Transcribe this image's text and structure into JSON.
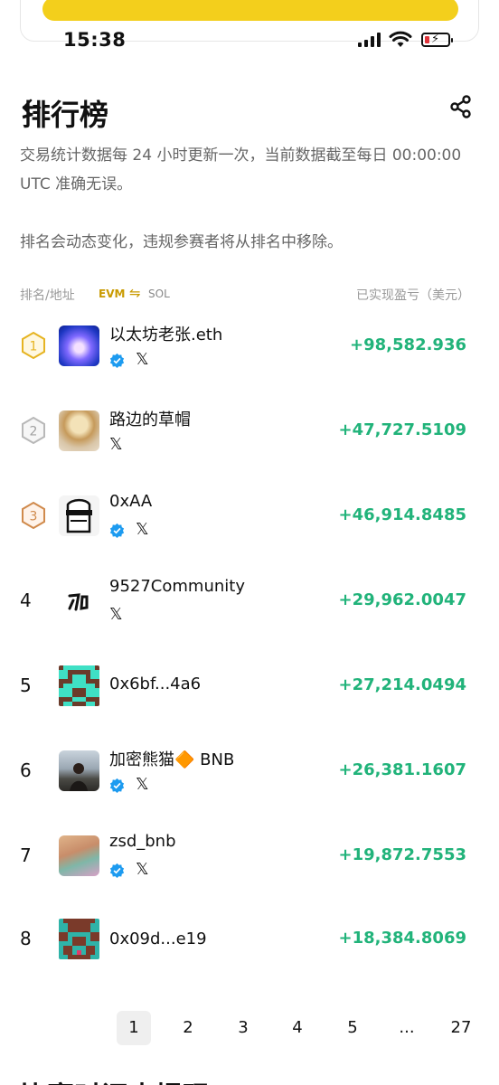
{
  "status_bar": {
    "time": "15:38"
  },
  "header": {
    "title": "排行榜",
    "back_icon": "arrow-left-icon",
    "share_icon": "share-icon"
  },
  "description": "交易统计数据每 24 小时更新一次，当前数据截至每日 00:00:00 UTC 准确无误。",
  "description2": "排名会动态变化，违规参赛者将从排名中移除。",
  "table": {
    "col_rank": "排名/地址",
    "chain_evm": "EVM",
    "chain_swap": "⇋",
    "chain_sol": "SOL",
    "col_pnl": "已实现盈亏（美元）"
  },
  "colors": {
    "positive": "#21b37a",
    "accent": "#f3cf1c"
  },
  "rows": [
    {
      "rank": "1",
      "name": "以太坊老张.eth",
      "verified": true,
      "pnl": "+98,582.936"
    },
    {
      "rank": "2",
      "name": "路边的草帽",
      "verified": false,
      "pnl": "+47,727.5109"
    },
    {
      "rank": "3",
      "name": "0xAA",
      "verified": true,
      "pnl": "+46,914.8485"
    },
    {
      "rank": "4",
      "name": "9527Community",
      "verified": false,
      "pnl": "+29,962.0047"
    },
    {
      "rank": "5",
      "name": "0x6bf...4a6",
      "verified": false,
      "pnl": "+27,214.0494"
    },
    {
      "rank": "6",
      "name": "加密熊猫🔶 BNB",
      "verified": true,
      "pnl": "+26,381.1607"
    },
    {
      "rank": "7",
      "name": "zsd_bnb",
      "verified": true,
      "pnl": "+19,872.7553"
    },
    {
      "rank": "8",
      "name": "0x09d...e19",
      "verified": false,
      "pnl": "+18,384.8069"
    }
  ],
  "pagination": {
    "pages": [
      "1",
      "2",
      "3",
      "4",
      "5",
      "...",
      "27"
    ],
    "current": "1"
  },
  "bottom_peek": "比赛时间内提现"
}
